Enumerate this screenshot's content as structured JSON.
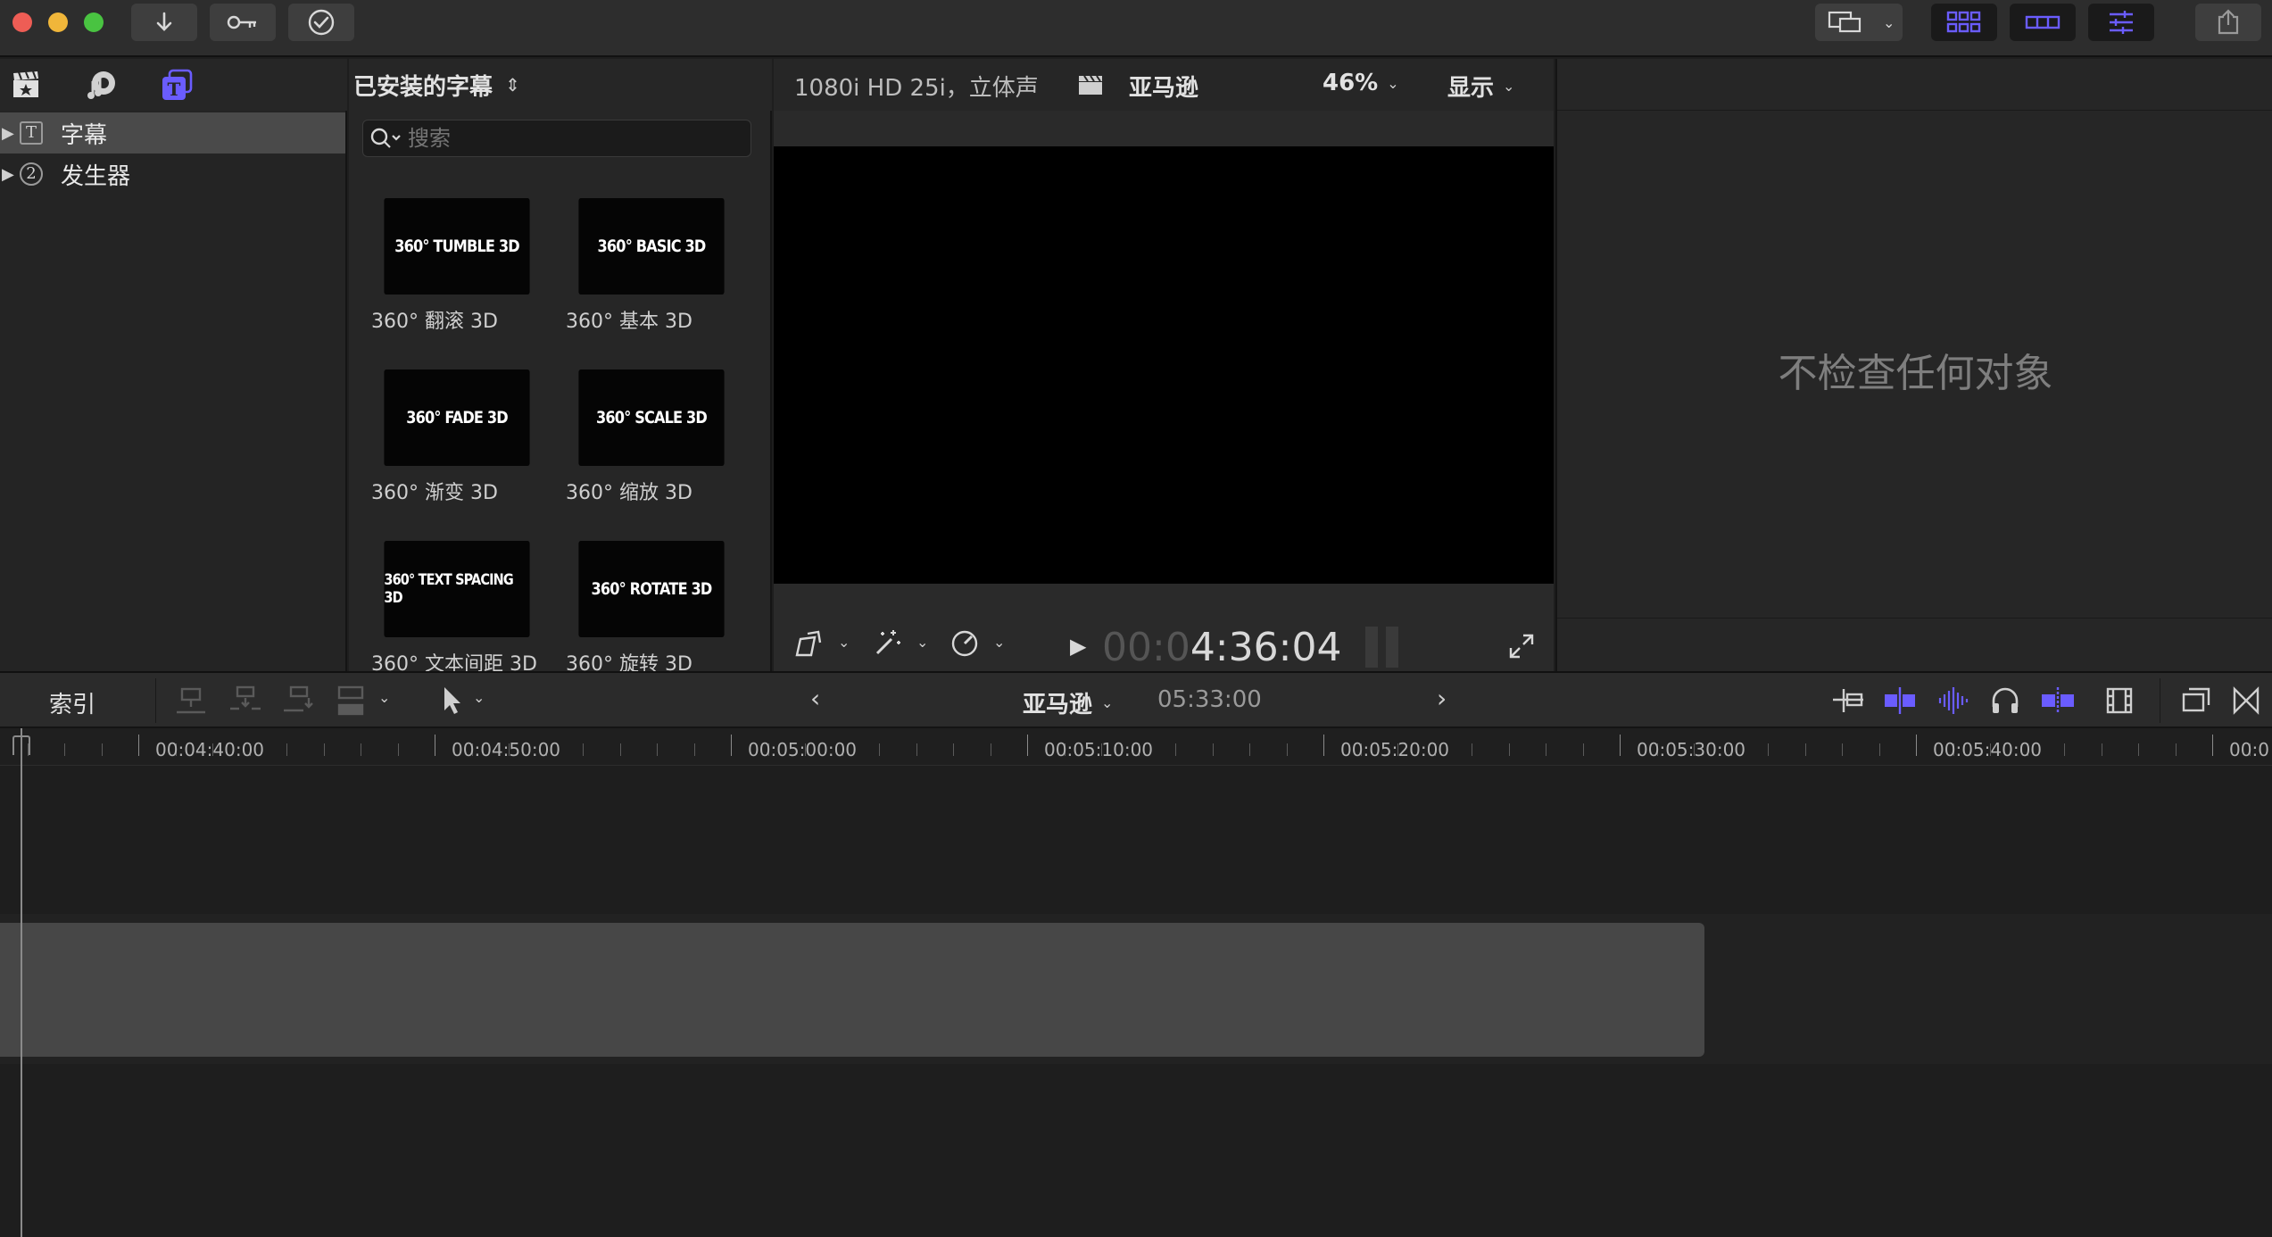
{
  "toolbar": {
    "colors": {
      "close": "#ee5d55",
      "minimize": "#f0b63a",
      "zoom": "#49c341",
      "accent": "#6a5cff"
    }
  },
  "library": {
    "items": [
      {
        "label": "字幕",
        "icon": "T"
      },
      {
        "label": "发生器",
        "icon": "2"
      }
    ]
  },
  "browser": {
    "title": "已安装的字幕",
    "search_placeholder": "搜索",
    "items": [
      {
        "thumb": "360° TUMBLE 3D",
        "label": "360° 翻滚 3D"
      },
      {
        "thumb": "360° BASIC 3D",
        "label": "360° 基本 3D"
      },
      {
        "thumb": "360° FADE 3D",
        "label": "360° 渐变 3D"
      },
      {
        "thumb": "360° SCALE 3D",
        "label": "360° 缩放 3D"
      },
      {
        "thumb": "360° TEXT SPACING 3D",
        "label": "360° 文本间距 3D"
      },
      {
        "thumb": "360° ROTATE 3D",
        "label": "360° 旋转 3D"
      }
    ]
  },
  "viewer": {
    "format": "1080i HD 25i，立体声",
    "project": "亚马逊",
    "zoom": "46%",
    "display_menu": "显示",
    "timecode_dim": "00:0",
    "timecode": "4:36:04"
  },
  "inspector": {
    "empty_message": "不检查任何对象"
  },
  "timeline": {
    "index_label": "索引",
    "project": "亚马逊",
    "duration": "05:33:00",
    "ruler_labels": [
      "00:04:40:00",
      "00:04:50:00",
      "00:05:00:00",
      "00:05:10:00",
      "00:05:20:00",
      "00:05:30:00",
      "00:05:40:00",
      "00:0"
    ]
  }
}
